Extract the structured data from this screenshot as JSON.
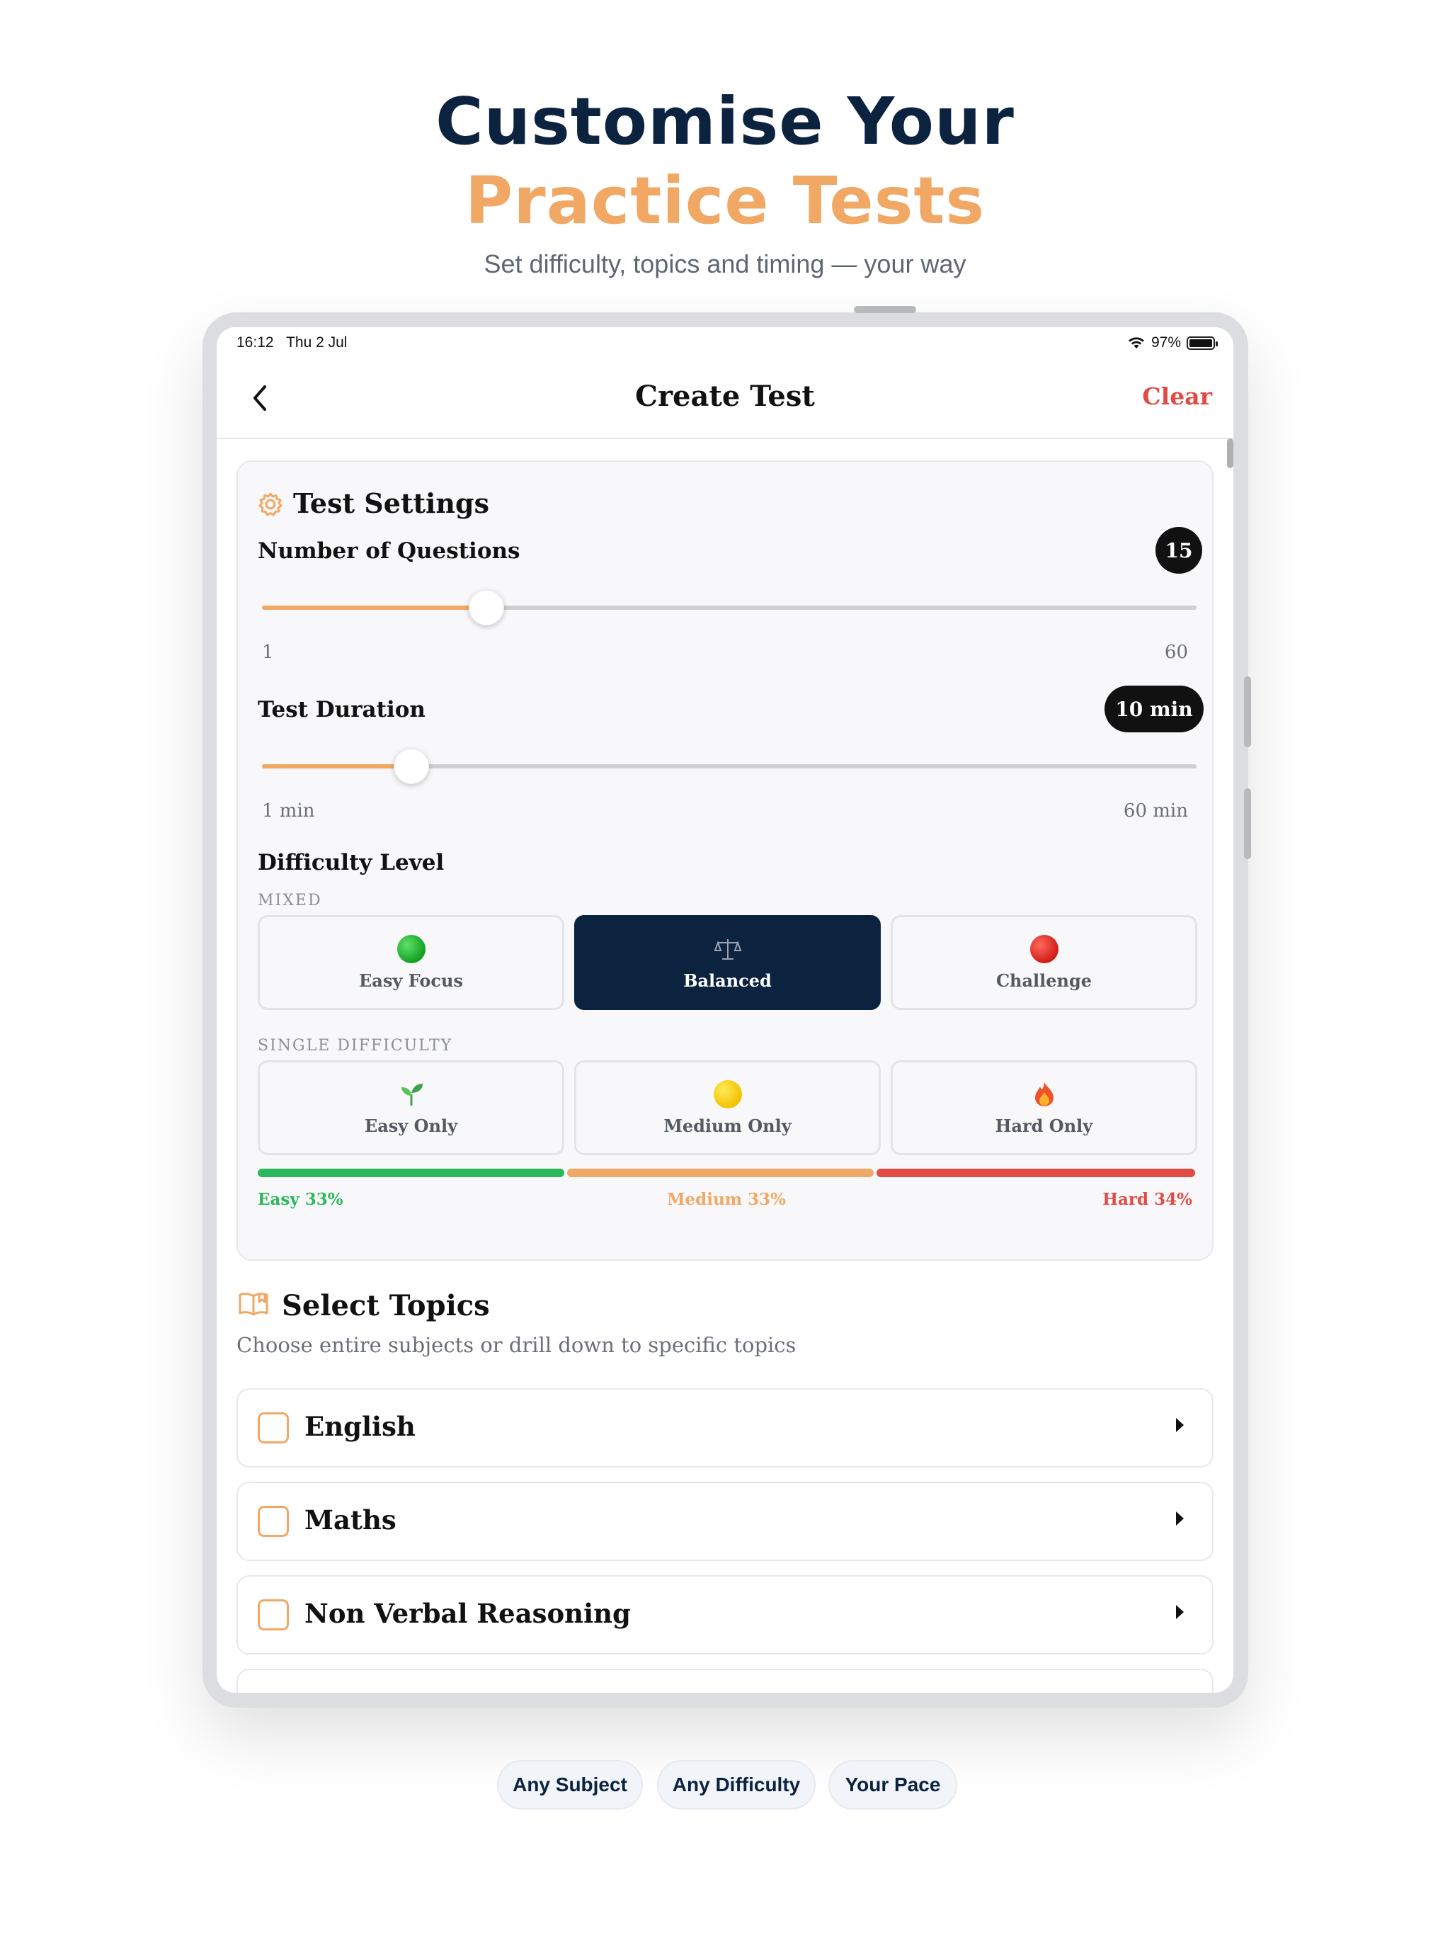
{
  "hero": {
    "line1": "Customise Your",
    "line2": "Practice Tests",
    "subtitle": "Set difficulty, topics and timing — your way"
  },
  "status_bar": {
    "time": "16:12",
    "date": "Thu 2 Jul",
    "battery": "97%"
  },
  "nav": {
    "title": "Create Test",
    "clear_label": "Clear",
    "back_icon": "chevron-left-icon"
  },
  "settings": {
    "title": "Test Settings",
    "icon": "gear-icon",
    "questions": {
      "label": "Number of Questions",
      "value": "15",
      "min_label": "1",
      "max_label": "60",
      "fraction": 0.24
    },
    "duration": {
      "label": "Test Duration",
      "value": "10 min",
      "min_label": "1 min",
      "max_label": "60 min",
      "fraction": 0.16
    },
    "difficulty": {
      "label": "Difficulty Level",
      "mixed_caption": "MIXED",
      "single_caption": "SINGLE DIFFICULTY",
      "mixed_options": [
        {
          "label": "Easy Focus",
          "icon": "green-circle-icon",
          "selected": false
        },
        {
          "label": "Balanced",
          "icon": "scales-icon",
          "selected": true
        },
        {
          "label": "Challenge",
          "icon": "red-circle-icon",
          "selected": false
        }
      ],
      "single_options": [
        {
          "label": "Easy Only",
          "icon": "seedling-icon"
        },
        {
          "label": "Medium Only",
          "icon": "yellow-circle-icon"
        },
        {
          "label": "Hard Only",
          "icon": "fire-icon"
        }
      ],
      "distribution": [
        {
          "label": "Easy 33%",
          "percent": 33,
          "color": "#2bb85c"
        },
        {
          "label": "Medium 33%",
          "percent": 33,
          "color": "#f2a865"
        },
        {
          "label": "Hard 34%",
          "percent": 34,
          "color": "#e14a45"
        }
      ]
    }
  },
  "topics": {
    "title": "Select Topics",
    "icon": "book-icon",
    "subtitle": "Choose entire subjects or drill down to specific topics",
    "items": [
      {
        "label": "English"
      },
      {
        "label": "Maths"
      },
      {
        "label": "Non Verbal Reasoning"
      }
    ]
  },
  "chips": [
    "Any Subject",
    "Any Difficulty",
    "Your Pace"
  ],
  "colors": {
    "navy": "#0c2340",
    "accent": "#f2a865",
    "danger": "#e14a45",
    "success": "#2bb85c"
  }
}
